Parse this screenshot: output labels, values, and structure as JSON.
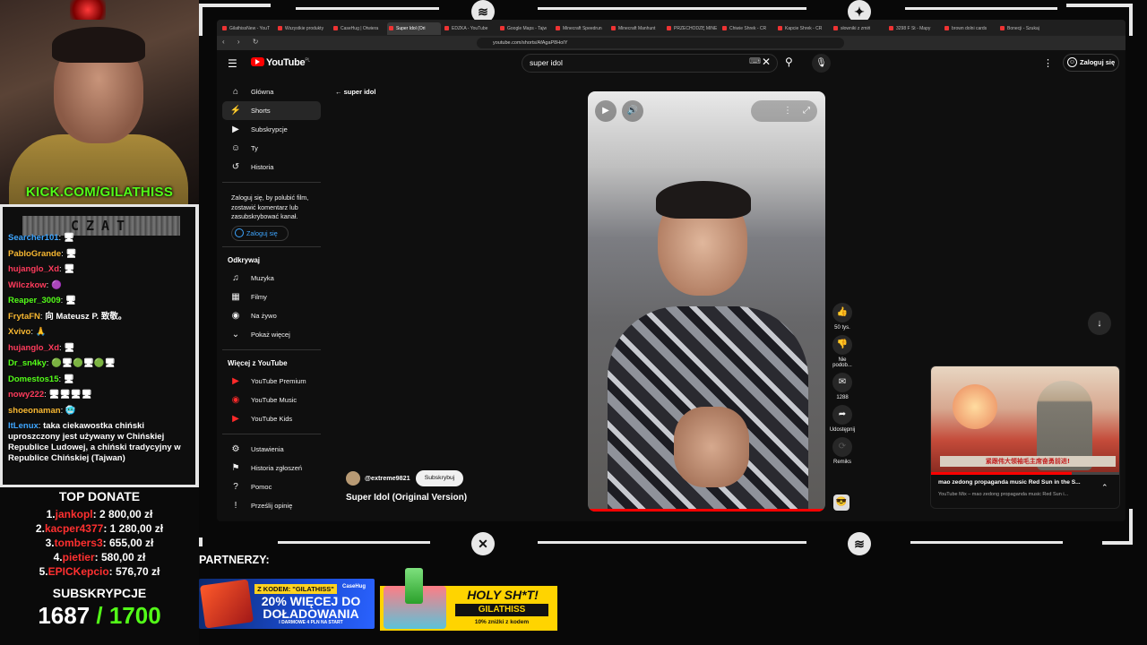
{
  "stream": {
    "kick_url": "KICK.COM/GILATHISS",
    "chat_header": "CZAT",
    "chat": [
      {
        "user": "Searcher101",
        "color": "#3ea6ff",
        "msg": "🖥"
      },
      {
        "user": "PabloGrande",
        "color": "#f7b731",
        "msg": "🖥"
      },
      {
        "user": "hujanglo_Xd",
        "color": "#ff3b5c",
        "msg": "🖥"
      },
      {
        "user": "Wilczkow",
        "color": "#ff3b5c",
        "msg": "🟣"
      },
      {
        "user": "Reaper_3009",
        "color": "#53fc18",
        "msg": "🖥"
      },
      {
        "user": "FrytaFN",
        "color": "#f7b731",
        "msg": "向 Mateusz P. 致敬。"
      },
      {
        "user": "Xvivo",
        "color": "#f7b731",
        "msg": "🙏"
      },
      {
        "user": "hujanglo_Xd",
        "color": "#ff3b5c",
        "msg": "🖥"
      },
      {
        "user": "Dr_sn4ky",
        "color": "#53fc18",
        "msg": "🟢🖥🟢🖥🟢🖥"
      },
      {
        "user": "Domestos15",
        "color": "#53fc18",
        "msg": "🖥"
      },
      {
        "user": "nowy222",
        "color": "#ff3b5c",
        "msg": "🖥🖥🖥🖥"
      },
      {
        "user": "shoeonaman",
        "color": "#f7b731",
        "msg": "🥶"
      }
    ],
    "chat_last": {
      "user": "ItLenux",
      "color": "#3ea6ff",
      "msg": "taka ciekawostka chiński uproszczony jest używany w Chińskiej Republice Ludowej, a chiński tradycyjny w Republice Chińskiej (Tajwan)"
    },
    "top_donate_title": "TOP DONATE",
    "donations": [
      {
        "rank": "1.",
        "name": "jankopl",
        "amount": "2 800,00 zł"
      },
      {
        "rank": "2.",
        "name": "kacper4377",
        "amount": "1 280,00 zł"
      },
      {
        "rank": "3.",
        "name": "tombers3",
        "amount": "655,00 zł"
      },
      {
        "rank": "4.",
        "name": "pietier",
        "amount": "580,00 zł"
      },
      {
        "rank": "5.",
        "name": "EPICKepcio",
        "amount": "576,70 zł"
      }
    ],
    "subs_title": "SUBSKRYPCJE",
    "subs_current": "1687",
    "subs_goal": "/ 1700",
    "partners_label": "PARTNERZY:",
    "partner1": {
      "code": "Z KODEM: \"GILATHISS\"",
      "brand": "CaseHug",
      "main": "20% WIĘCEJ DO DOŁADOWANIA",
      "sub": "I DARMOWE 4 PLN NA START"
    },
    "partner2": {
      "main": "HOLY SH*T!",
      "code": "GILATHISS",
      "sub": "10% zniżki z kodem"
    }
  },
  "browser": {
    "tabs": [
      "GilathissNew - YouT",
      "Wszystkie produkty",
      "CaseHug | Otwiera",
      "Super Idol (Ori",
      "EDZKA - YouTube",
      "Google Maps - Tajw",
      "Minecraft Speedrun",
      "Minecraft Manhunt",
      "PRZECHODZĘ MINE",
      "Chiwie Shrek - CR",
      "Kapcie Shrek - CR",
      "słowniki z zmiń",
      "3298 F St - Mapy",
      "brown dolni cards",
      "Bonecji - Szukaj"
    ],
    "active_tab": 3,
    "url": "youtube.com/shorts/AfAgaP8HoIY"
  },
  "youtube": {
    "logo_text": "YouTube",
    "logo_region": "PL",
    "search_value": "super idol",
    "signin_label": "Zaloguj się",
    "sidebar_main": [
      {
        "icon": "home-icon",
        "glyph": "⌂",
        "label": "Główna",
        "active": false
      },
      {
        "icon": "shorts-icon",
        "glyph": "⚡",
        "label": "Shorts",
        "active": true
      },
      {
        "icon": "subscriptions-icon",
        "glyph": "▶",
        "label": "Subskrypcje",
        "active": false
      },
      {
        "icon": "you-icon",
        "glyph": "☺",
        "label": "Ty",
        "active": false
      },
      {
        "icon": "history-icon",
        "glyph": "↺",
        "label": "Historia",
        "active": false
      }
    ],
    "signin_note": "Zaloguj się, by polubić film, zostawić komentarz lub zasubskrybować kanał.",
    "signin_side_label": "Zaloguj się",
    "explore_title": "Odkrywaj",
    "explore": [
      {
        "icon": "music-icon",
        "glyph": "♫",
        "label": "Muzyka"
      },
      {
        "icon": "movies-icon",
        "glyph": "▦",
        "label": "Filmy"
      },
      {
        "icon": "live-icon",
        "glyph": "◉",
        "label": "Na żywo"
      },
      {
        "icon": "chevron-down-icon",
        "glyph": "⌄",
        "label": "Pokaż więcej"
      }
    ],
    "more_title": "Więcej z YouTube",
    "more": [
      {
        "icon": "yt-premium-icon",
        "glyph": "▶",
        "label": "YouTube Premium"
      },
      {
        "icon": "yt-music-icon",
        "glyph": "◉",
        "label": "YouTube Music"
      },
      {
        "icon": "yt-kids-icon",
        "glyph": "▶",
        "label": "YouTube Kids"
      }
    ],
    "footer_items": [
      {
        "icon": "settings-icon",
        "glyph": "⚙",
        "label": "Ustawienia"
      },
      {
        "icon": "flag-icon",
        "glyph": "⚑",
        "label": "Historia zgłoszeń"
      },
      {
        "icon": "help-icon",
        "glyph": "?",
        "label": "Pomoc"
      },
      {
        "icon": "feedback-icon",
        "glyph": "!",
        "label": "Prześlij opinię"
      }
    ],
    "back_query": "super idol",
    "channel": "@extreme9821",
    "subscribe_label": "Subskrybuj",
    "video_title": "Super Idol (Original Version)",
    "video_progress": 1.0,
    "actions": [
      {
        "icon": "like-icon",
        "glyph": "👍",
        "label": "50 tys.",
        "dim": false
      },
      {
        "icon": "dislike-icon",
        "glyph": "👎",
        "label": "Nie podob...",
        "dim": false
      },
      {
        "icon": "comment-icon",
        "glyph": "✉",
        "label": "1288",
        "dim": false
      },
      {
        "icon": "share-icon",
        "glyph": "➦",
        "label": "Udostępnij",
        "dim": false
      },
      {
        "icon": "remix-icon",
        "glyph": "⟳",
        "label": "Remiks",
        "dim": true
      }
    ],
    "mini_player": {
      "title": "mao zedong propaganda music Red Sun in the S...",
      "subtitle": "YouTube Mix – mao zedong propaganda music Red Sun i...",
      "banner": "紧跟伟大领袖毛主席奋勇前进!",
      "progress": 0.74
    }
  }
}
